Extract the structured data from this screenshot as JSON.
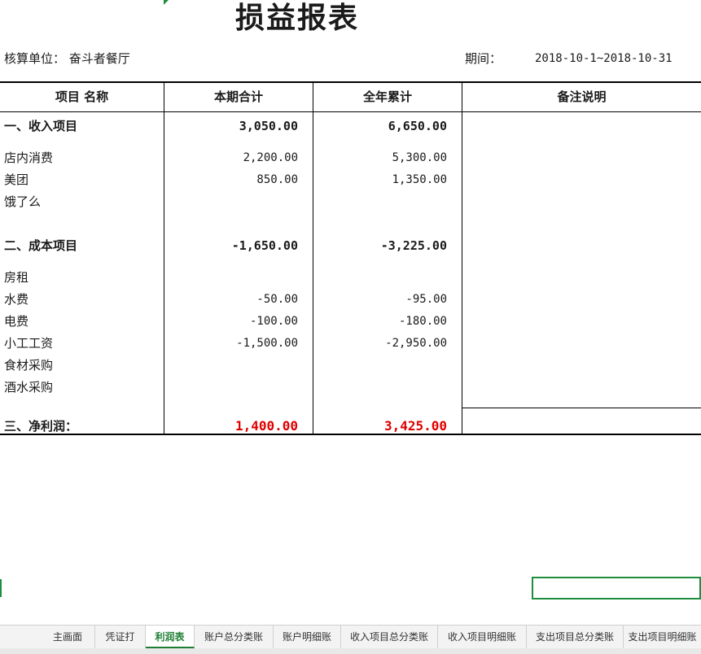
{
  "report": {
    "title": "损益报表",
    "unit_text": "核算单位： 奋斗者餐厅",
    "period_label": "期间：",
    "period_value": "2018-10-1~2018-10-31"
  },
  "table": {
    "headers": [
      "项目 名称",
      "本期合计",
      "全年累计",
      "备注说明"
    ],
    "income": {
      "label": "一、收入项目",
      "current": "3,050.00",
      "ytd": "6,650.00",
      "items": [
        {
          "name": "店内消费",
          "current": "2,200.00",
          "ytd": "5,300.00"
        },
        {
          "name": "美团",
          "current": "850.00",
          "ytd": "1,350.00"
        },
        {
          "name": "饿了么",
          "current": "",
          "ytd": ""
        }
      ]
    },
    "cost": {
      "label": "二、成本项目",
      "current": "-1,650.00",
      "ytd": "-3,225.00",
      "items": [
        {
          "name": "房租",
          "current": "",
          "ytd": ""
        },
        {
          "name": "水费",
          "current": "-50.00",
          "ytd": "-95.00"
        },
        {
          "name": "电费",
          "current": "-100.00",
          "ytd": "-180.00"
        },
        {
          "name": "小工工资",
          "current": "-1,500.00",
          "ytd": "-2,950.00"
        },
        {
          "name": "食材采购",
          "current": "",
          "ytd": ""
        },
        {
          "name": "酒水采购",
          "current": "",
          "ytd": ""
        }
      ]
    },
    "profit": {
      "label": "三、净利润：",
      "current": "1,400.00",
      "ytd": "3,425.00"
    }
  },
  "sheet_tabs": [
    "主画面",
    "凭证打",
    "利润表",
    "账户总分类账",
    "账户明细账",
    "收入项目总分类账",
    "收入项目明细账",
    "支出项目总分类账",
    "支出项目明细账"
  ],
  "active_tab": "利润表",
  "colors": {
    "accent": "#1e8e3e",
    "negative_highlight": "#e00000"
  }
}
